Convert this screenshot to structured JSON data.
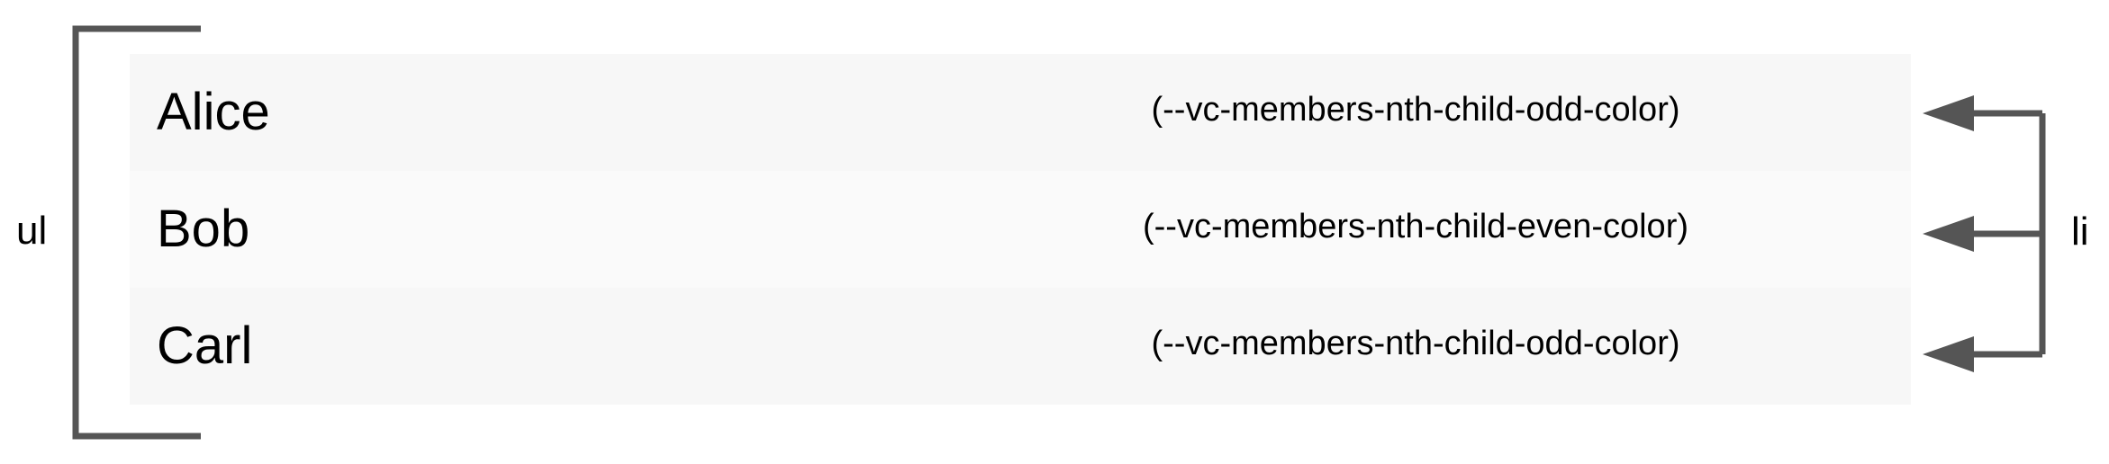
{
  "labels": {
    "ul": "ul",
    "li": "li"
  },
  "items": [
    {
      "name": "Alice",
      "variable": "(--vc-members-nth-child-odd-color)",
      "parity": "odd"
    },
    {
      "name": "Bob",
      "variable": "(--vc-members-nth-child-even-color)",
      "parity": "even"
    },
    {
      "name": "Carl",
      "variable": "(--vc-members-nth-child-odd-color)",
      "parity": "odd"
    }
  ],
  "colors": {
    "odd_row": "#f7f7f7",
    "even_row": "#fafafa",
    "connector": "#555555",
    "text": "#000000"
  }
}
